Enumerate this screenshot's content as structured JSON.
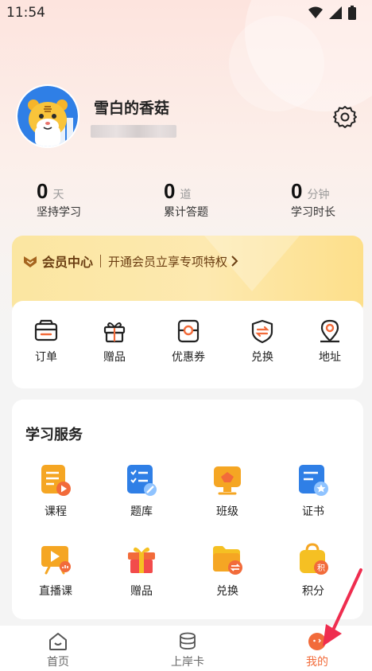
{
  "status_bar": {
    "time": "11:54"
  },
  "profile": {
    "username": "雪白的香菇"
  },
  "stats": [
    {
      "value": "0",
      "unit": "天",
      "label": "坚持学习"
    },
    {
      "value": "0",
      "unit": "道",
      "label": "累计答题"
    },
    {
      "value": "0",
      "unit": "分钟",
      "label": "学习时长"
    }
  ],
  "vip": {
    "title": "会员中心",
    "desc": "开通会员立享专项特权"
  },
  "orders": [
    {
      "label": "订单",
      "icon": "wallet-icon"
    },
    {
      "label": "赠品",
      "icon": "gift-icon"
    },
    {
      "label": "优惠券",
      "icon": "coupon-icon"
    },
    {
      "label": "兑换",
      "icon": "exchange-icon"
    },
    {
      "label": "地址",
      "icon": "location-icon"
    }
  ],
  "services": {
    "title": "学习服务",
    "items": [
      {
        "label": "课程",
        "icon": "course-icon"
      },
      {
        "label": "题库",
        "icon": "question-bank-icon"
      },
      {
        "label": "班级",
        "icon": "class-icon"
      },
      {
        "label": "证书",
        "icon": "certificate-icon"
      },
      {
        "label": "直播课",
        "icon": "live-class-icon"
      },
      {
        "label": "赠品",
        "icon": "gift-box-icon"
      },
      {
        "label": "兑换",
        "icon": "exchange-folder-icon"
      },
      {
        "label": "积分",
        "icon": "points-bag-icon"
      }
    ]
  },
  "bottom_nav": [
    {
      "label": "首页",
      "icon": "home-icon"
    },
    {
      "label": "上岸卡",
      "icon": "card-stack-icon"
    },
    {
      "label": "我的",
      "icon": "me-icon",
      "active": true
    }
  ],
  "colors": {
    "accent": "#f26b3a",
    "vip_text": "#6b3e12",
    "vip_bg": "#fde9b0"
  }
}
